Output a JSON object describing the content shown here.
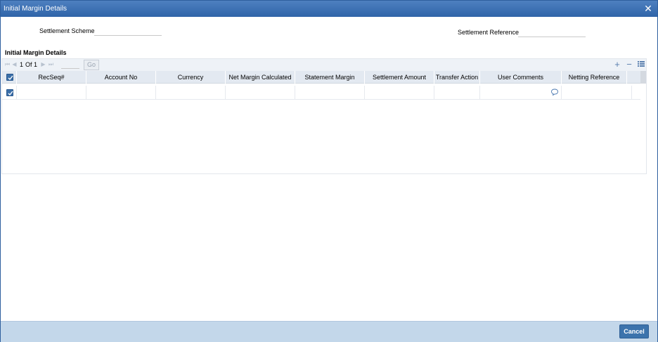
{
  "window": {
    "title": "Initial Margin Details"
  },
  "header": {
    "settlement_scheme_label": "Settlement Scheme",
    "settlement_scheme_value": "",
    "settlement_reference_label": "Settlement Reference",
    "settlement_reference_value": ""
  },
  "grid": {
    "section_title": "Initial Margin Details",
    "pagination": {
      "current": "1",
      "of_label": "Of",
      "total": "1",
      "go_label": "Go",
      "go_value": ""
    },
    "columns": [
      "RecSeq#",
      "Account No",
      "Currency",
      "Net Margin Calculated",
      "Statement Margin",
      "Settlement Amount",
      "Transfer Action",
      "User Comments",
      "Netting Reference"
    ],
    "rows": [
      {
        "checked": true,
        "cells": [
          "",
          "",
          "",
          "",
          "",
          "",
          "",
          "",
          ""
        ]
      }
    ]
  },
  "footer": {
    "cancel_label": "Cancel"
  },
  "colors": {
    "titlebar": "#3a6ead",
    "footer": "#c3d7ea",
    "accent": "#3c73ac"
  },
  "icons": [
    "close-icon",
    "first-page-icon",
    "prev-page-icon",
    "next-page-icon",
    "last-page-icon",
    "add-row-icon",
    "delete-row-icon",
    "single-view-icon",
    "comment-icon",
    "checkbox-icon"
  ]
}
